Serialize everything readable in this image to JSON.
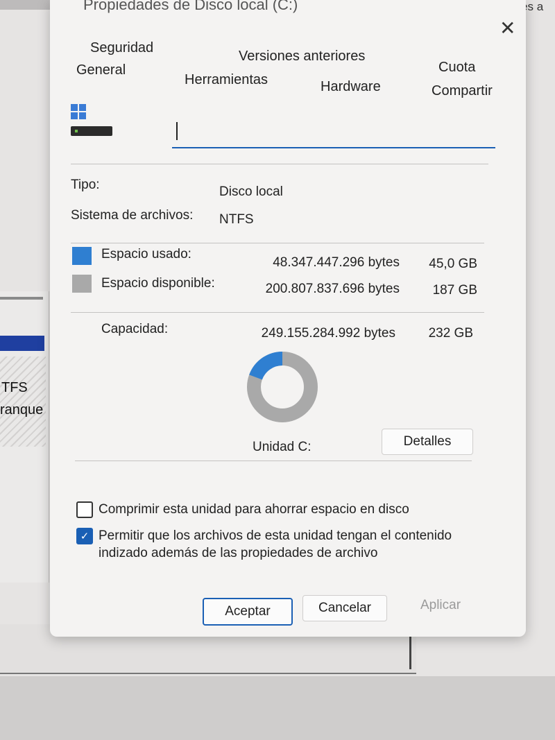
{
  "background": {
    "right_title": "Acciones a",
    "left_text1": "TFS",
    "left_text2": "ranque"
  },
  "dialog": {
    "title": "Propiedades de Disco local (C:)",
    "tabs": {
      "seguridad": "Seguridad",
      "versiones": "Versiones anteriores",
      "cuota": "Cuota",
      "general": "General",
      "herramientas": "Herramientas",
      "hardware": "Hardware",
      "compartir": "Compartir"
    },
    "drive_name_value": "",
    "info": {
      "tipo_label": "Tipo:",
      "tipo_value": "Disco local",
      "fs_label": "Sistema de archivos:",
      "fs_value": "NTFS"
    },
    "space": {
      "used_label": "Espacio usado:",
      "used_bytes": "48.347.447.296 bytes",
      "used_size": "45,0 GB",
      "free_label": "Espacio disponible:",
      "free_bytes": "200.807.837.696 bytes",
      "free_size": "187 GB",
      "cap_label": "Capacidad:",
      "cap_bytes": "249.155.284.992 bytes",
      "cap_size": "232 GB",
      "used_fraction": 0.194,
      "used_color": "#2f7fd1",
      "free_color": "#a9a9a9"
    },
    "drive_label": "Unidad C:",
    "details_button": "Detalles",
    "compress_label": "Comprimir esta unidad para ahorrar espacio en disco",
    "compress_checked": false,
    "index_label_line1": "Permitir que los archivos de esta unidad tengan el contenido",
    "index_label_line2": "indizado además de las propiedades de archivo",
    "index_checked": true,
    "buttons": {
      "ok": "Aceptar",
      "cancel": "Cancelar",
      "apply": "Aplicar"
    }
  }
}
